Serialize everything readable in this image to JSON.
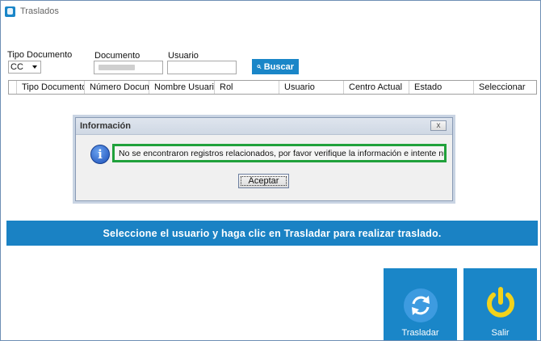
{
  "window": {
    "title": "Traslados",
    "icon": "app-icon"
  },
  "filters": {
    "tipo_documento_label": "Tipo Documento",
    "tipo_documento_value": "CC",
    "documento_label": "Documento",
    "documento_value": "",
    "usuario_label": "Usuario",
    "usuario_value": "",
    "buscar_label": "Buscar",
    "buscar_icon": "search-icon"
  },
  "grid": {
    "columns": [
      "Tipo Documento",
      "Número Docum...",
      "Nombre Usuario",
      "Rol",
      "Usuario",
      "Centro Actual",
      "Estado",
      "Seleccionar"
    ],
    "rows": []
  },
  "dialog": {
    "title": "Información",
    "close_label": "x",
    "icon": "info-icon",
    "message": "No se encontraron registros relacionados, por favor verifique la información e intente nuevamente",
    "accept_label": "Aceptar"
  },
  "banner": {
    "text": "Seleccione el usuario y haga clic en Trasladar para realizar traslado."
  },
  "actions": {
    "trasladar_label": "Trasladar",
    "trasladar_icon": "sync-icon",
    "salir_label": "Salir",
    "salir_icon": "power-icon"
  },
  "colors": {
    "accent": "#1a86c8",
    "highlight": "#20a13b",
    "power": "#f2d21b"
  }
}
